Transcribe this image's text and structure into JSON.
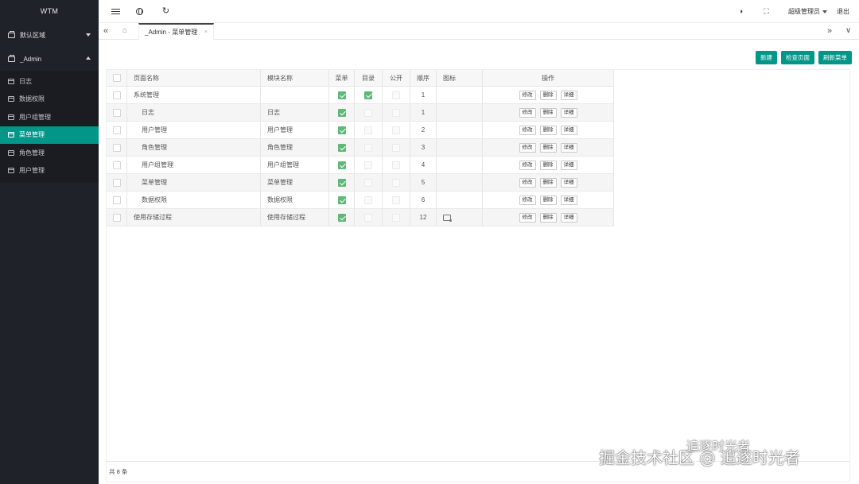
{
  "app": {
    "logo": "WTM"
  },
  "sidebar": {
    "groups": [
      {
        "label": "默认区域",
        "expanded": false
      },
      {
        "label": "_Admin",
        "expanded": true
      }
    ],
    "items": [
      {
        "label": "日志"
      },
      {
        "label": "数据权限"
      },
      {
        "label": "用户组管理"
      },
      {
        "label": "菜单管理",
        "active": true
      },
      {
        "label": "角色管理"
      },
      {
        "label": "用户管理"
      }
    ]
  },
  "header": {
    "user": "超级管理员",
    "logout": "退出"
  },
  "tabs": {
    "active": "_Admin - 菜单管理",
    "close": "×"
  },
  "toolbar": {
    "create": "新建",
    "check_pages": "检查页面",
    "refresh_menu": "刷新菜单"
  },
  "table": {
    "columns": [
      "页面名称",
      "模块名称",
      "菜单",
      "目录",
      "公开",
      "顺序",
      "图标",
      "操作"
    ],
    "ops": {
      "edit": "修改",
      "delete": "删除",
      "detail": "详细"
    },
    "rows": [
      {
        "page": "系统管理",
        "module": "",
        "menu": true,
        "folder": true,
        "public": false,
        "order": "1",
        "icon": false,
        "child": false
      },
      {
        "page": "日志",
        "module": "日志",
        "menu": true,
        "folder": false,
        "public": false,
        "order": "1",
        "icon": false,
        "child": true
      },
      {
        "page": "用户管理",
        "module": "用户管理",
        "menu": true,
        "folder": false,
        "public": false,
        "order": "2",
        "icon": false,
        "child": true
      },
      {
        "page": "角色管理",
        "module": "角色管理",
        "menu": true,
        "folder": false,
        "public": false,
        "order": "3",
        "icon": false,
        "child": true
      },
      {
        "page": "用户组管理",
        "module": "用户组管理",
        "menu": true,
        "folder": false,
        "public": false,
        "order": "4",
        "icon": false,
        "child": true
      },
      {
        "page": "菜单管理",
        "module": "菜单管理",
        "menu": true,
        "folder": false,
        "public": false,
        "order": "5",
        "icon": false,
        "child": true
      },
      {
        "page": "数据权限",
        "module": "数据权限",
        "menu": true,
        "folder": false,
        "public": false,
        "order": "6",
        "icon": false,
        "child": true
      },
      {
        "page": "使用存储过程",
        "module": "使用存储过程",
        "menu": true,
        "folder": false,
        "public": false,
        "order": "12",
        "icon": true,
        "child": false
      }
    ]
  },
  "footer": {
    "total": "共 8 条"
  },
  "watermark": {
    "main": "掘金技术社区 @ 追逐时光者",
    "sub": "追逐时光者"
  },
  "colors": {
    "sidebar_bg": "#20222a",
    "accent": "#009688",
    "check": "#5fb878"
  }
}
